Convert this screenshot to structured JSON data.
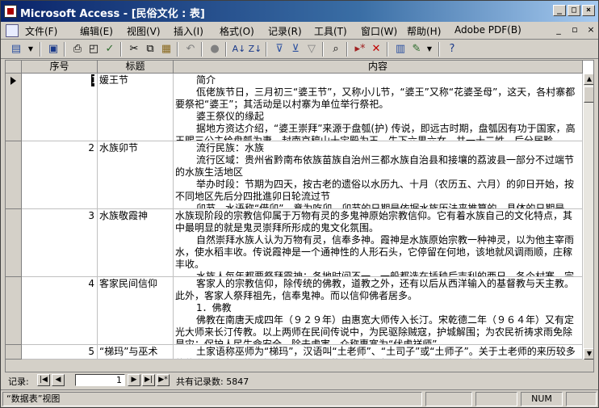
{
  "window": {
    "title": "Microsoft Access - [民俗文化 : 表]"
  },
  "menu": [
    "文件(F)",
    "编辑(E)",
    "视图(V)",
    "插入(I)",
    "格式(O)",
    "记录(R)",
    "工具(T)",
    "窗口(W)",
    "帮助(H)",
    "Adobe PDF(B)"
  ],
  "toolbar_icons": [
    "view-icon",
    "save-icon",
    "print-icon",
    "print-preview-icon",
    "spelling-icon",
    "cut-icon",
    "copy-icon",
    "paste-icon",
    "undo-icon",
    "hyperlink-icon",
    "sort-ascending-icon",
    "sort-descending-icon",
    "filter-by-selection-icon",
    "filter-by-form-icon",
    "apply-filter-icon",
    "find-icon",
    "new-record-icon",
    "delete-record-icon",
    "database-window-icon",
    "new-object-icon",
    "help-icon"
  ],
  "table": {
    "columns": [
      "序号",
      "标题",
      "内容"
    ],
    "rows": [
      {
        "id": "1",
        "title": "媛王节",
        "content": [
          "简介",
          "佤佬族节日，三月初三“婆王节”，又称小儿节，“婆王”又称“花婆圣母”，这天，各村寨都要祭祀“婆王”；其活动是以村寨为单位举行祭祀。",
          "婆王祭仪的缘起",
          "据地方资达介绍，“婆王崇拜”来源于盘瓠(护) 传说，即远古时期，盘瓠因有功于国家，高王赐三公主给盘瓠为妻，封南京稿山十宝殿为王，生下六男六女，共一十二姓。后分居黔"
        ]
      },
      {
        "id": "2",
        "title": "水族卯节",
        "content": [
          "流行民族：水族",
          "流行区域：贵州省黔南布依族苗族自治州三都水族自治县和接壤的荔波县一部分不过端节的水族生活地区",
          "举办时段：节期为四天，按古老的遗俗以水历九、十月（农历五、六月）的卯日开始，按不同地区先后分四批進卯日轮流过节",
          "卯节，水语称“借卯”，意为吃卯。卯节的日期是依据水族历法来推算的，具体的日期是"
        ]
      },
      {
        "id": "3",
        "title": "水族敬霞神",
        "content": [
          "水族现阶段的宗教信仰属于万物有灵的多鬼神原始宗教信仰。它有着水族自己的文化特点，其中最明显的就是鬼灵崇拜所形成的鬼文化氛围。",
          "自然崇拜水族人认为万物有灵，信奉多神。霞神是水族原始宗教一种神灵，以为他主宰雨水，使水稻丰收。传说霞神是一个通神性的人形石头，它停留在何地，该地就风调雨顺，庄稼丰收。",
          "水族人每年都要祭拜霞神；各地时间不一，一般都选在插秧后吉利的酉日，各个村寨、宗"
        ]
      },
      {
        "id": "4",
        "title": "客家民间信仰",
        "content": [
          "客家人的宗教信仰，除传统的佛教，道教之外，还有以后从西洋输入的基督教与天主教。此外，客家人祭拜祖先，信奉鬼神。而以信仰佛者居多。",
          "1．佛教",
          "佛教在南唐天成四年（９２９年）由惠宽大师传入长汀。宋乾德二年（９６４年）又有定光大师来长汀传教。以上两师在民间传说中，为民驱除贼寇，护城解围；为农民祈祷求雨免除旱灾；保护人民生命安全，除去虎害，众称惠宽为“伏虎祥师”。"
        ]
      },
      {
        "id": "5",
        "title": "“梯玛”与巫术",
        "content": [
          "土家语称巫师为“梯玛”，汉语叫“土老师”、“土司子”或“土师子”。关于土老师的来历较多的传说是土老师的祖师去西天取经，获得半本经书，八个铜铃，在回来的路上，客老师的祖师用半本经书换了八个铜铃。土老师便是从一本经书和八个铜铃发展起来的。"
        ]
      }
    ]
  },
  "nav": {
    "label": "记录:",
    "current": "1",
    "total_label": "共有记录数: 5847"
  },
  "status": {
    "view_label": "“数据表”视图",
    "num": "NUM"
  }
}
